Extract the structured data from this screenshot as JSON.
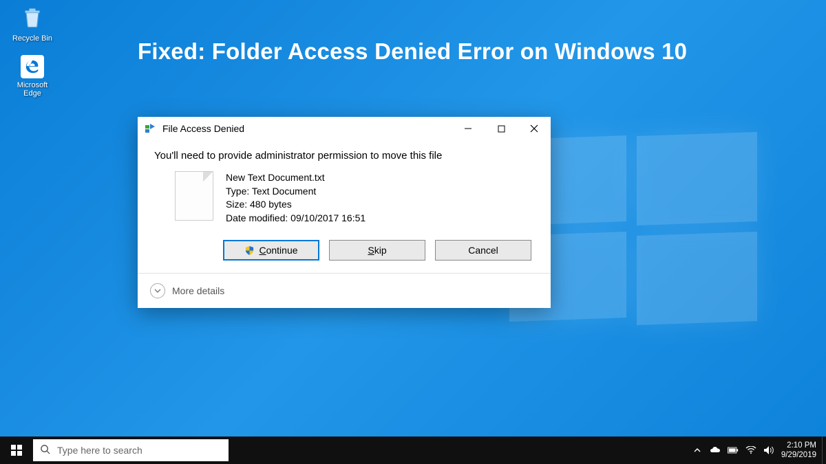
{
  "banner": {
    "headline": "Fixed: Folder Access Denied Error on Windows 10"
  },
  "desktop": {
    "recycle_bin_label": "Recycle Bin",
    "edge_label": "Microsoft Edge"
  },
  "dialog": {
    "title": "File Access Denied",
    "message": "You'll need to provide administrator permission to move this file",
    "file": {
      "name": "New Text Document.txt",
      "type_line": "Type: Text Document",
      "size_line": "Size: 480 bytes",
      "modified_line": "Date modified: 09/10/2017 16:51"
    },
    "buttons": {
      "continue": "Continue",
      "skip": "Skip",
      "cancel": "Cancel"
    },
    "more_details": "More details"
  },
  "taskbar": {
    "search_placeholder": "Type here to search",
    "clock": {
      "time": "2:10 PM",
      "date": "9/29/2019"
    }
  }
}
